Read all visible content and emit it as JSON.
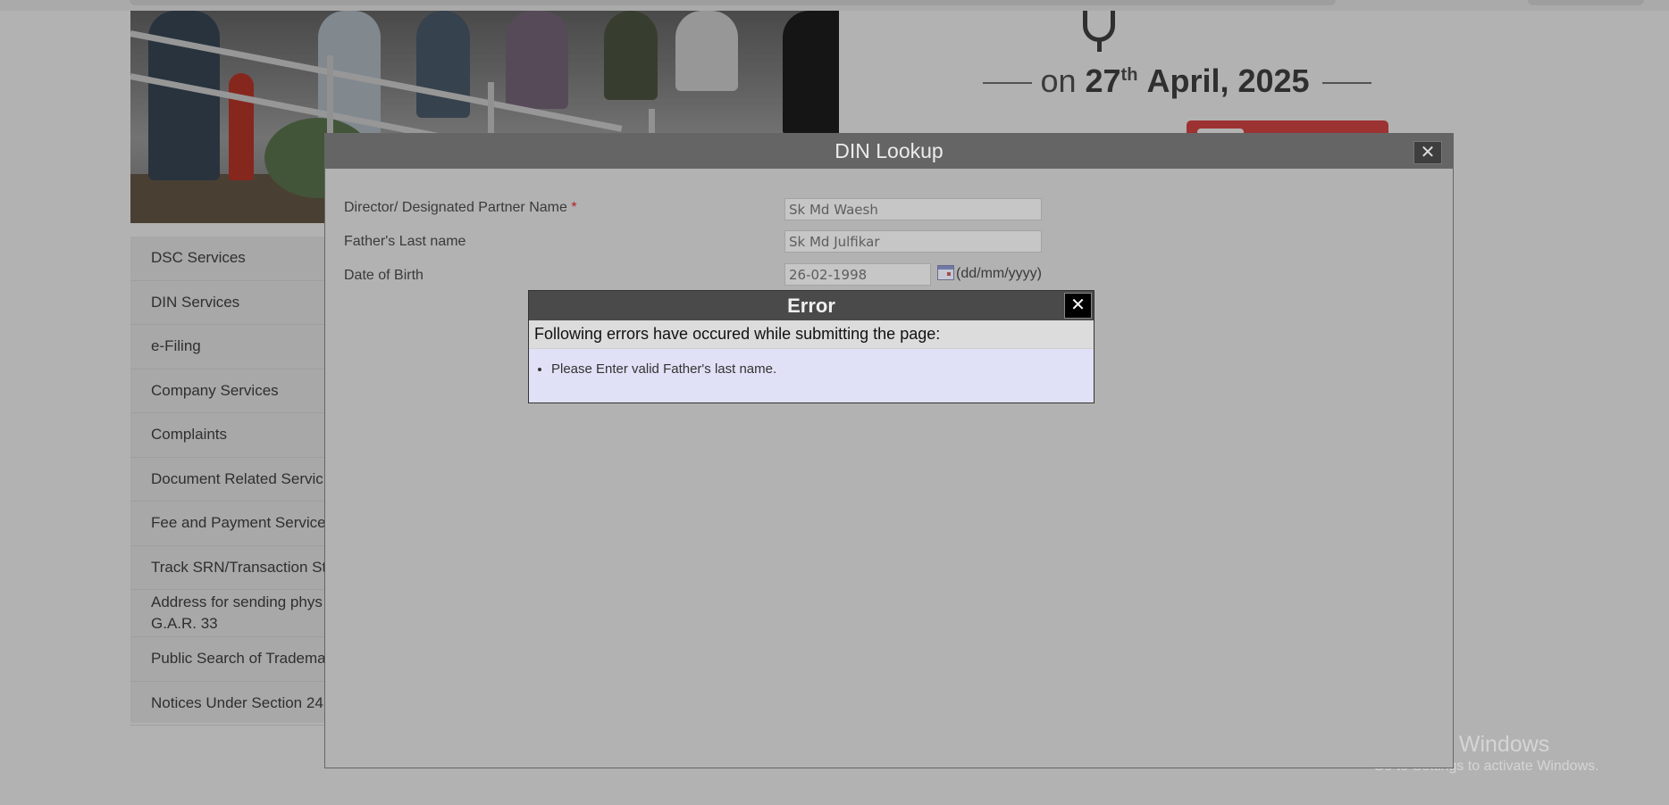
{
  "banner": {
    "date_prefix": "on",
    "date_day": "27",
    "date_suffix": "th",
    "date_rest": "April, 2025"
  },
  "sidebar": {
    "items": [
      {
        "label": "DSC Services"
      },
      {
        "label": "DIN Services"
      },
      {
        "label": "e-Filing"
      },
      {
        "label": "Company Services"
      },
      {
        "label": "Complaints"
      },
      {
        "label": "Document Related Servic"
      },
      {
        "label": "Fee and Payment Services"
      },
      {
        "label": "Track SRN/Transaction Sta"
      },
      {
        "label": "Address for sending phys copy of G.A.R. 33"
      },
      {
        "label": "Public Search of Tradema"
      },
      {
        "label": "Notices Under Section 24"
      }
    ]
  },
  "watermark": {
    "line1": "Activate Windows",
    "line2": "Go to Settings to activate Windows."
  },
  "din_dialog": {
    "title": "DIN Lookup",
    "close_glyph": "✕",
    "fields": {
      "name_label": "Director/ Designated Partner Name",
      "required_mark": "*",
      "name_value": "Sk Md Waesh",
      "father_label": "Father's Last name",
      "father_value": "Sk Md Julfikar",
      "dob_label": "Date of Birth",
      "dob_value": "26-02-1998",
      "dob_format": "(dd/mm/yyyy)"
    }
  },
  "error_dialog": {
    "title": "Error",
    "close_glyph": "✕",
    "subtitle": "Following errors have occured while submitting the page:",
    "errors": [
      "Please Enter valid Father's last name."
    ]
  }
}
